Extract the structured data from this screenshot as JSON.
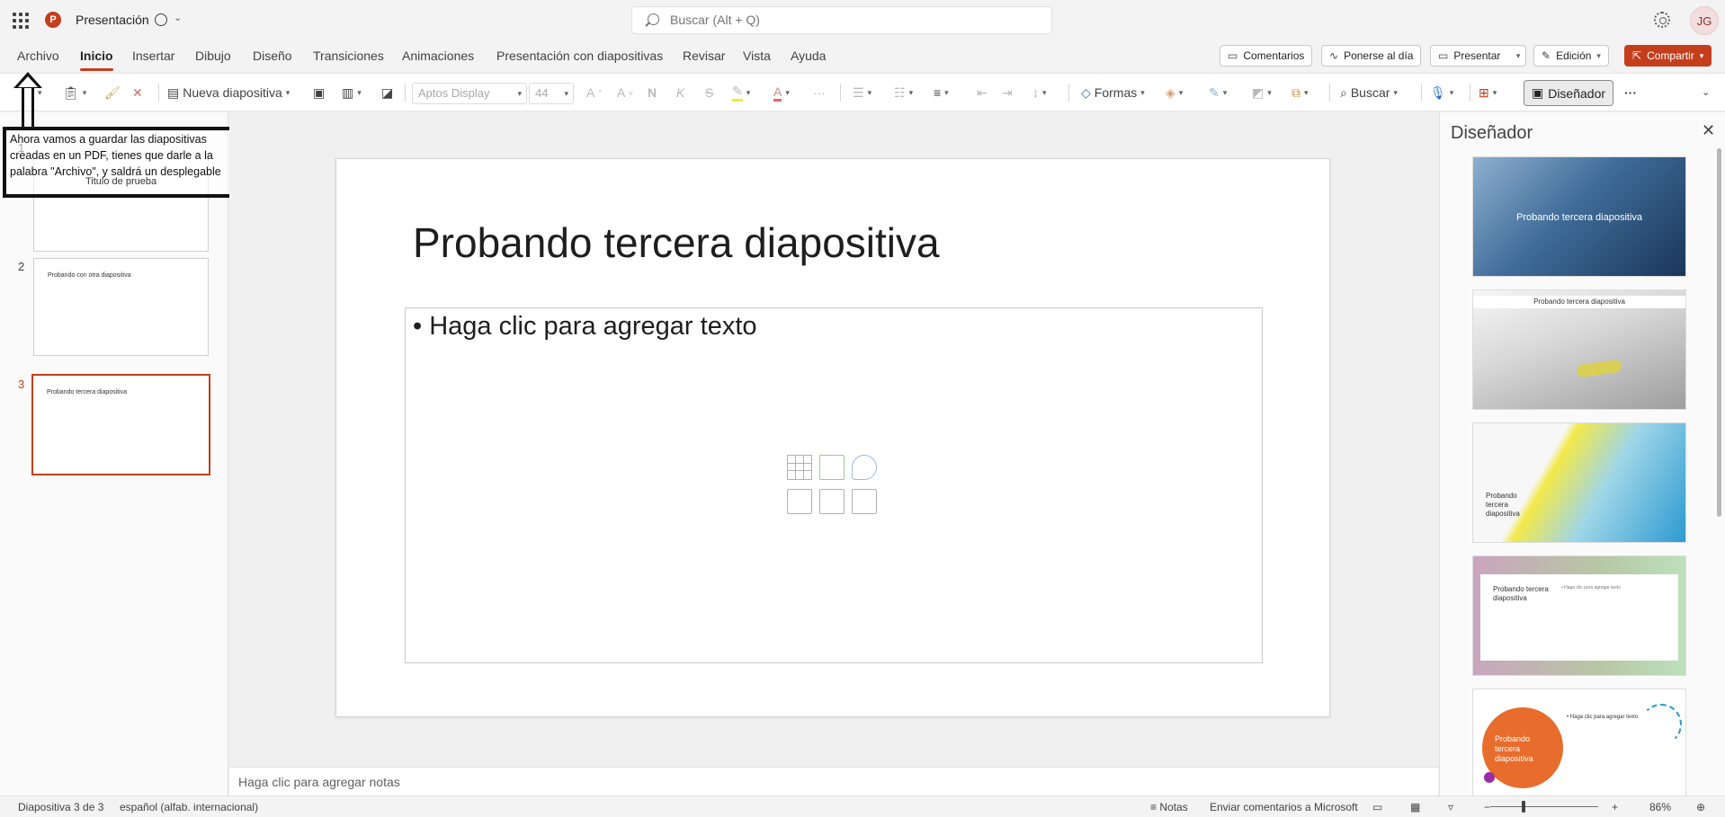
{
  "titlebar": {
    "doc_name": "Presentación",
    "search_placeholder": "Buscar (Alt + Q)",
    "user_initials": "JG"
  },
  "tabs": [
    "Archivo",
    "Inicio",
    "Insertar",
    "Dibujo",
    "Diseño",
    "Transiciones",
    "Animaciones",
    "Presentación con diapositivas",
    "Revisar",
    "Vista",
    "Ayuda"
  ],
  "active_tab": "Inicio",
  "ribbon_buttons": {
    "comments": "Comentarios",
    "catch_up": "Ponerse al día",
    "present": "Presentar",
    "editing": "Edición",
    "share": "Compartir"
  },
  "toolbar": {
    "new_slide": "Nueva diapositiva",
    "font_name": "Aptos Display",
    "font_size": "44",
    "bold": "N",
    "italic": "K",
    "strike": "S",
    "shapes": "Formas",
    "find": "Buscar",
    "designer": "Diseñador",
    "more": "···"
  },
  "annotation": {
    "text": "Ahora vamos a guardar las diapositivas creadas en un PDF, tienes que darle a la palabra \"Archivo\", y saldrá un desplegable"
  },
  "slides": [
    {
      "number": "1",
      "title": "Titulo de prueba"
    },
    {
      "number": "2",
      "title": "Probando con otra diapositiva"
    },
    {
      "number": "3",
      "title": "Probando tercera diapositiva"
    }
  ],
  "current_slide": {
    "title": "Probando tercera diapositiva",
    "body_placeholder": "• Haga clic para agregar texto"
  },
  "notes_placeholder": "Haga clic para agregar notas",
  "designer_pane": {
    "title": "Diseñador",
    "designs": [
      {
        "label": "Probando tercera diapositiva"
      },
      {
        "label": "Probando tercera diapositiva"
      },
      {
        "label": "Probando tercera diapositiva"
      },
      {
        "label": "Probando tercera diapositiva",
        "body": "• Haga clic para agregar texto"
      },
      {
        "label": "Probando tercera diapositiva",
        "body": "• Haga clic para agregar texto"
      }
    ]
  },
  "statusbar": {
    "slide_info": "Diapositiva 3 de 3",
    "language": "español (alfab. internacional)",
    "notes": "Notas",
    "feedback": "Enviar comentarios a Microsoft",
    "zoom": "86%",
    "zoom_out": "−",
    "zoom_in": "+"
  },
  "colors": {
    "accent": "#c43e1c",
    "ribbon_bg": "#f3f3f3"
  }
}
